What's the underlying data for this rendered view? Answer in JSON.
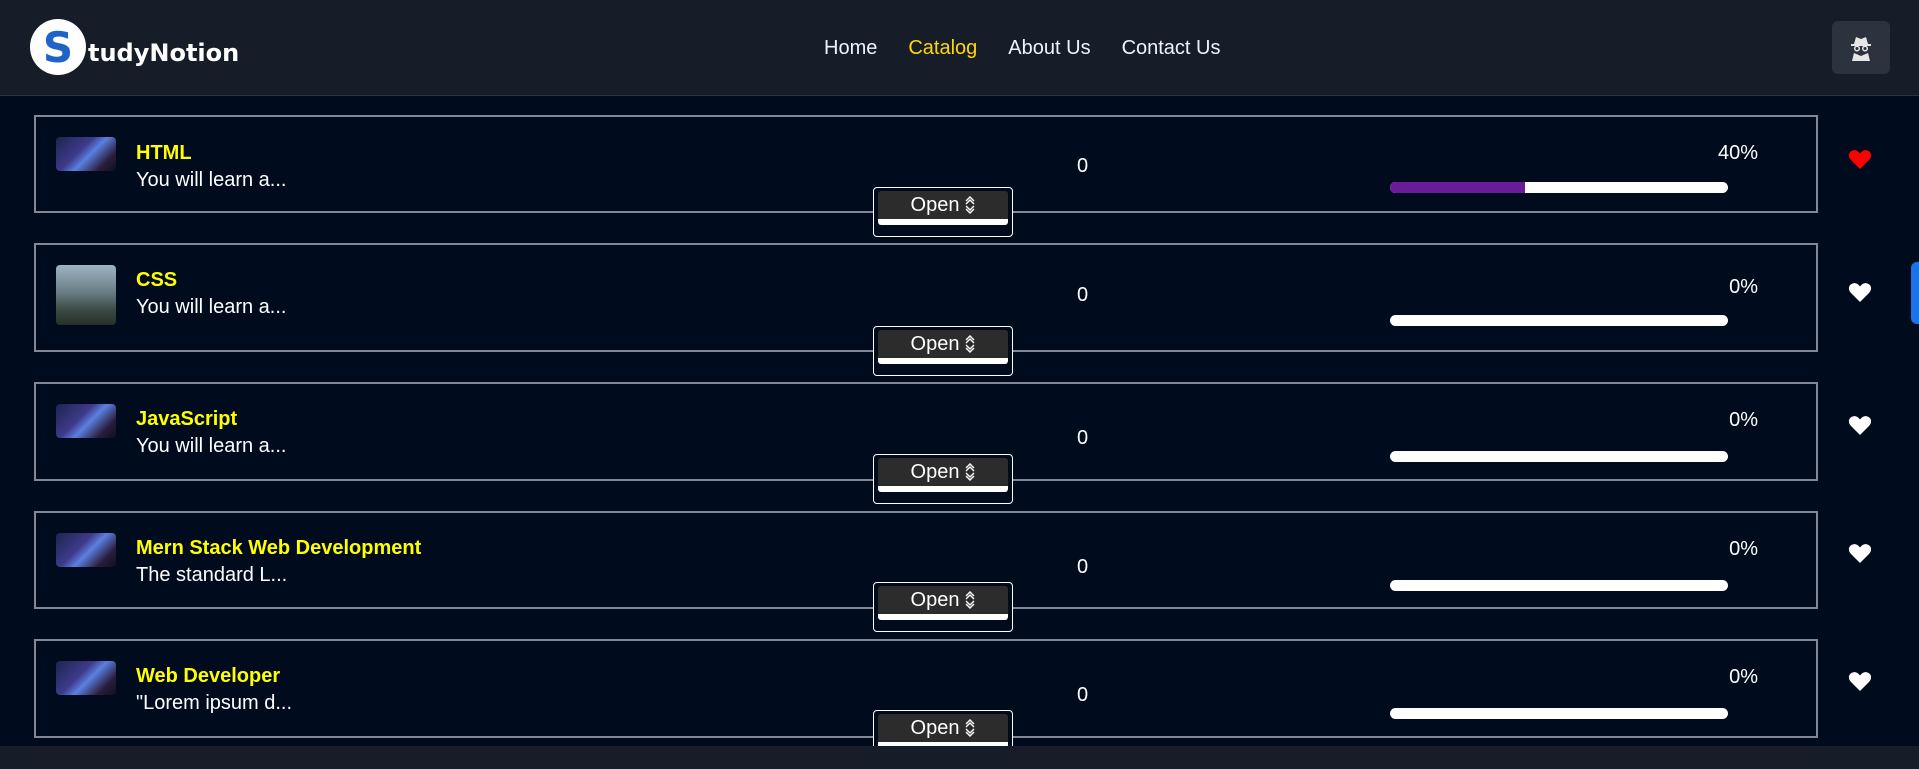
{
  "brand": {
    "logo_letter": "S",
    "name": "tudyNotion"
  },
  "nav": [
    {
      "label": "Home",
      "active": false
    },
    {
      "label": "Catalog",
      "active": true
    },
    {
      "label": "About Us",
      "active": false
    },
    {
      "label": "Contact Us",
      "active": false
    }
  ],
  "colors": {
    "accent": "#ffd60a",
    "title": "#ffff00",
    "progress": "#6a1b9a",
    "liked": "#ff0000",
    "scroll": "#1a73e8"
  },
  "open_label": "Open",
  "courses": [
    {
      "title": "HTML",
      "desc": "You will learn a...",
      "count": "0",
      "percent": "40%",
      "progress": 0.4,
      "liked": true,
      "thumb": "night-scene"
    },
    {
      "title": "CSS",
      "desc": "You will learn a...",
      "count": "0",
      "percent": "0%",
      "progress": 0,
      "liked": false,
      "thumb": "forest-scene"
    },
    {
      "title": "JavaScript",
      "desc": "You will learn a...",
      "count": "0",
      "percent": "0%",
      "progress": 0,
      "liked": false,
      "thumb": "night-scene"
    },
    {
      "title": "Mern Stack Web Development",
      "desc": "The standard L...",
      "count": "0",
      "percent": "0%",
      "progress": 0,
      "liked": false,
      "thumb": "night-scene"
    },
    {
      "title": "Web Developer",
      "desc": "\"Lorem ipsum d...",
      "count": "0",
      "percent": "0%",
      "progress": 0,
      "liked": false,
      "thumb": "night-scene"
    }
  ]
}
